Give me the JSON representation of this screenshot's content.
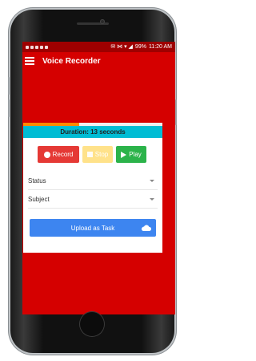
{
  "status_bar": {
    "battery": "99%",
    "time": "11:20 AM"
  },
  "toolbar": {
    "title": "Voice Recorder"
  },
  "recording": {
    "duration_text": "Duration: 13 seconds",
    "progress_fraction": 0.4
  },
  "controls": {
    "record_label": "Record",
    "stop_label": "Stop",
    "play_label": "Play"
  },
  "form": {
    "status_label": "Status",
    "subject_label": "Subject"
  },
  "upload": {
    "label": "Upload as Task"
  },
  "colors": {
    "app_bar": "#d50000",
    "status_bar": "#9e0000",
    "duration_bar": "#00bcd4",
    "progress": "#ff8a00",
    "record": "#e53935",
    "stop_disabled": "#ffe28a",
    "play": "#2bb34a",
    "upload": "#3d85f0"
  },
  "icons": [
    "menu-icon",
    "record-dot-icon",
    "stop-square-icon",
    "play-triangle-icon",
    "dropdown-caret-icon",
    "cloud-icon"
  ]
}
